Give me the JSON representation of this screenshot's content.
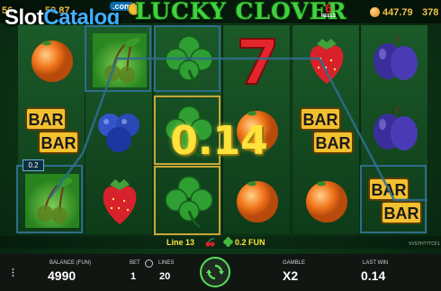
{
  "watermark": {
    "slot": "Slot",
    "catalog": "Catalog",
    "com": ".com"
  },
  "header": {
    "left_values": [
      "56",
      "59.87"
    ],
    "title": "LUCKY CLOVER",
    "badge_number": "6",
    "badge_text": "REELS",
    "right_value": "447.79",
    "right_value_2": "378"
  },
  "reels": [
    {
      "id": 1,
      "symbols": [
        "orange",
        "bar",
        "cherries"
      ]
    },
    {
      "id": 2,
      "symbols": [
        "cherries",
        "blueberries",
        "strawberry"
      ]
    },
    {
      "id": 3,
      "symbols": [
        "clover",
        "clover",
        "clover"
      ]
    },
    {
      "id": 4,
      "symbols": [
        "seven",
        "orange",
        "orange"
      ]
    },
    {
      "id": 5,
      "symbols": [
        "strawberry",
        "bar",
        "orange"
      ]
    },
    {
      "id": 6,
      "symbols": [
        "plums",
        "plums",
        "bar"
      ]
    }
  ],
  "win": {
    "line_box": "0.2",
    "amount": "0.14"
  },
  "info": {
    "line": "Line 13",
    "fun": "0.2 FUN",
    "version": "VVSTH?7TCF1"
  },
  "bottom": {
    "balance_label": "BALANCE (FUN)",
    "balance": "4990",
    "bet_label": "BET",
    "bet": "1",
    "lines_label": "LINES",
    "lines": "20",
    "gamble_label": "GAMBLE",
    "gamble": "X2",
    "last_win_label": "LAST WIN",
    "last_win": "0.14"
  },
  "icons": {
    "spin": "spin-arrows-icon",
    "menu": "menu-dots-icon",
    "bet": "bet-toggle-icon",
    "coin": "coin-icon",
    "mini_cherry": "cherry-icon",
    "mini_clover": "clover-icon"
  },
  "colors": {
    "win_text": "#ffe23a",
    "title_green": "#3fd23c",
    "spin_ring": "#58e05a",
    "frame_blue": "#2e6d8c",
    "frame_gold": "#c9a536"
  }
}
